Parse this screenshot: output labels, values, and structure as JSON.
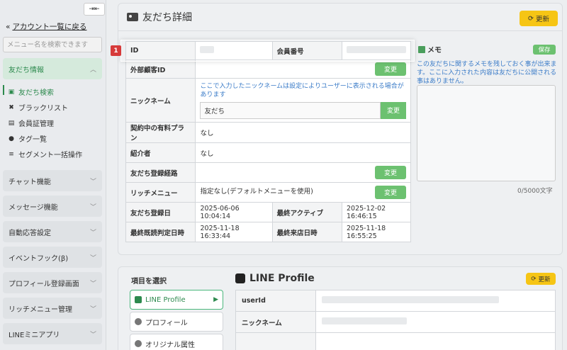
{
  "sidebar": {
    "back_label": "アカウント一覧に戻る",
    "search_placeholder": "メニュー名を検索できます",
    "friends_group": "友だち情報",
    "sub_items": [
      "友だち検索",
      "ブラックリスト",
      "会員証管理",
      "タグ一覧",
      "セグメント一括操作"
    ],
    "groups": [
      "チャット機能",
      "メッセージ機能",
      "自動応答設定",
      "イベントフック(β)",
      "プロフィール登録画面",
      "リッチメニュー管理",
      "LINEミニアプリ"
    ]
  },
  "detail": {
    "title": "友だち詳細",
    "refresh_label": "更新",
    "badge": "1",
    "change_label": "変更",
    "rows": {
      "id_label": "ID",
      "member_label": "会員番号",
      "external_label": "外部顧客ID",
      "nickname_label": "ニックネーム",
      "nickname_note": "ここで入力したニックネームは設定によりユーザーに表示される場合があります",
      "nickname_value": "友だち",
      "plan_label": "契約中の有料プラン",
      "plan_value": "なし",
      "referrer_label": "紹介者",
      "referrer_value": "なし",
      "route_label": "友だち登録経路",
      "richmenu_label": "リッチメニュー",
      "richmenu_value": "指定なし(デフォルトメニューを使用)",
      "registered_label": "友だち登録日",
      "registered_value": "2025-06-06 10:04:14",
      "last_active_label": "最終アクティブ",
      "last_active_value": "2025-12-02 16:46:15",
      "last_read_label": "最終既読判定日時",
      "last_read_value": "2025-11-18 16:33:44",
      "last_visit_label": "最終来店日時",
      "last_visit_value": "2025-11-18 16:55:25"
    }
  },
  "memo": {
    "title": "メモ",
    "save_label": "保存",
    "note": "この友だちに関するメモを残しておく事が出来ます。ここに入力された内容は友だちに公開される事はありません。",
    "count": "0/5000文字"
  },
  "profile": {
    "select_title": "項目を選択",
    "items": [
      "LINE Profile",
      "プロフィール",
      "オリジナル属性"
    ],
    "title": "LINE Profile",
    "refresh_label": "更新",
    "userid_label": "userId",
    "nickname_label": "ニックネーム"
  }
}
